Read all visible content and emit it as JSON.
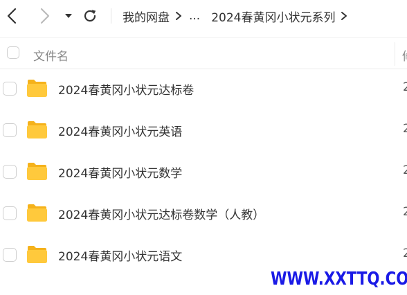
{
  "nav": {
    "back_icon": "chevron-left-icon",
    "forward_icon": "chevron-right-icon",
    "dropdown_icon": "caret-down-icon",
    "refresh_icon": "refresh-icon"
  },
  "breadcrumb": {
    "root": "我的网盘",
    "ellipsis": "...",
    "current": "2024春黄冈小状元系列"
  },
  "header": {
    "name_label": "文件名",
    "second_col_label": "修"
  },
  "files": [
    {
      "name": "2024春黄冈小状元达标卷",
      "date": "2",
      "icon": "folder-icon"
    },
    {
      "name": "2024春黄冈小状元英语",
      "date": "2",
      "icon": "folder-icon"
    },
    {
      "name": "2024春黄冈小状元数学",
      "date": "2",
      "icon": "folder-icon"
    },
    {
      "name": "2024春黄冈小状元达标卷数学（人教）",
      "date": "2",
      "icon": "folder-icon"
    },
    {
      "name": "2024春黄冈小状元语文",
      "date": "2",
      "icon": "folder-icon"
    }
  ],
  "watermark": "WWW.XXTTQ.COM",
  "colors": {
    "folder_body": "#FFC93C",
    "folder_tab": "#F5B21B",
    "watermark": "#1A1AE6",
    "text": "#333333",
    "muted": "#888888"
  }
}
